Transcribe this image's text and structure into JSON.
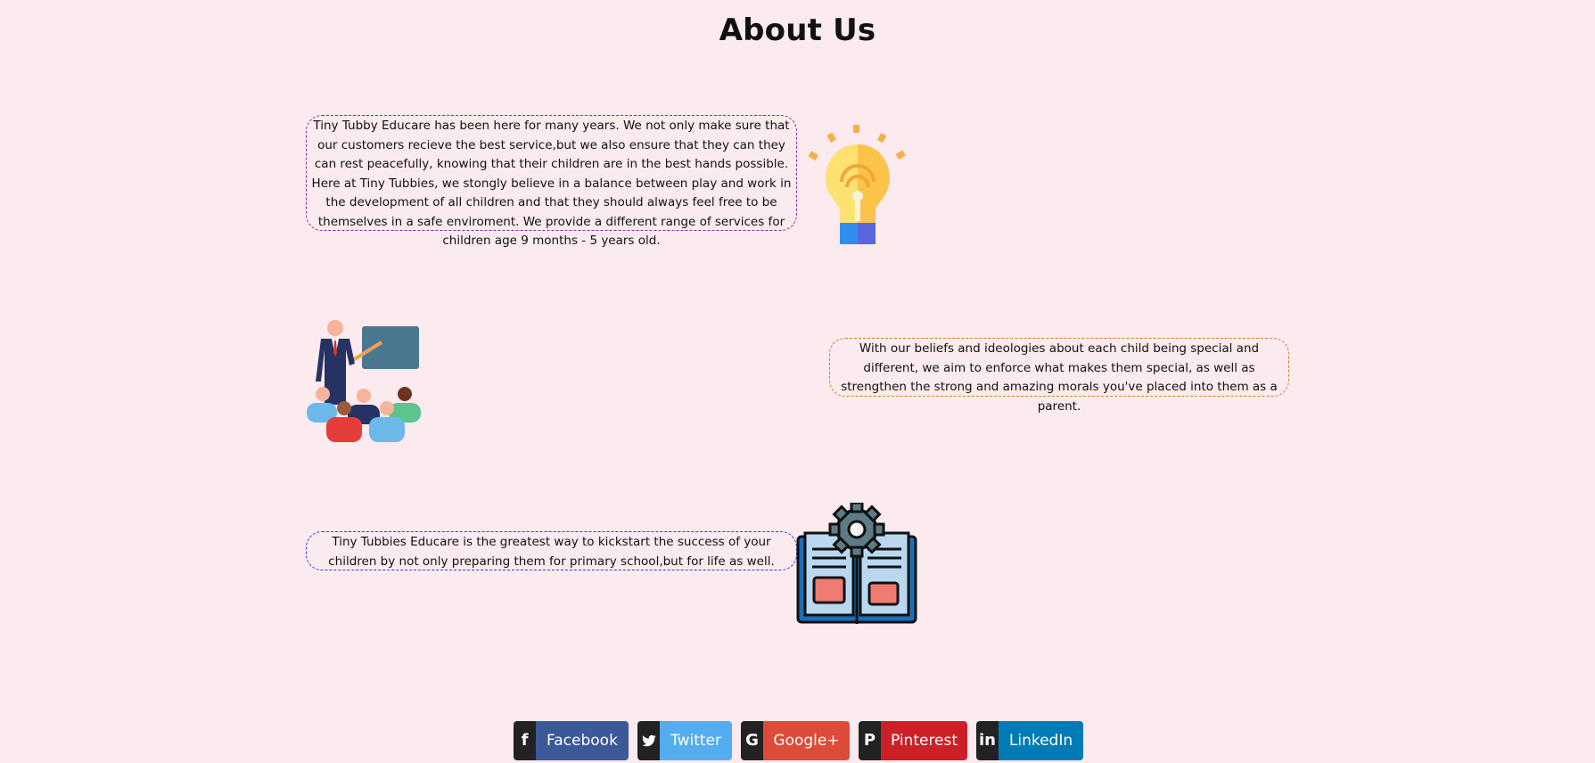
{
  "page": {
    "title": "About Us",
    "background_color": "#fbeaee"
  },
  "sections": [
    {
      "text": "Tiny Tubby Educare has been here for many years. We not only make sure that our customers recieve the best service,but we also ensure that they can they can rest peacefully, knowing that their children are in the best hands possible. Here at Tiny Tubbies, we stongly believe in a balance between play and work in the development of all children and that they should always feel free to be themselves in a safe enviroment. We provide a different range of services for children age 9 months - 5 years old.",
      "border_color": "#8a2c98",
      "illustration": "lightbulb-icon"
    },
    {
      "text": "With our beliefs and ideologies about each child being special and different, we aim to enforce what makes them special, as well as strengthen the strong and amazing morals you've placed into them as a parent.",
      "border_color": "#d47f2a",
      "illustration": "teacher-classroom-icon"
    },
    {
      "text": "Tiny Tubbies Educare is the greatest way to kickstart the success of your children by not only preparing them for primary school,but for life as well.",
      "border_color": "#3a3ad6",
      "illustration": "book-gear-icon"
    }
  ],
  "social": {
    "buttons": [
      {
        "label": "Facebook",
        "icon": "facebook-icon",
        "color": "#3b5998"
      },
      {
        "label": "Twitter",
        "icon": "twitter-icon",
        "color": "#55acee"
      },
      {
        "label": "Google+",
        "icon": "google-plus-icon",
        "color": "#dd4b39"
      },
      {
        "label": "Pinterest",
        "icon": "pinterest-icon",
        "color": "#cb2027"
      },
      {
        "label": "LinkedIn",
        "icon": "linkedin-icon",
        "color": "#007bb5"
      }
    ]
  }
}
